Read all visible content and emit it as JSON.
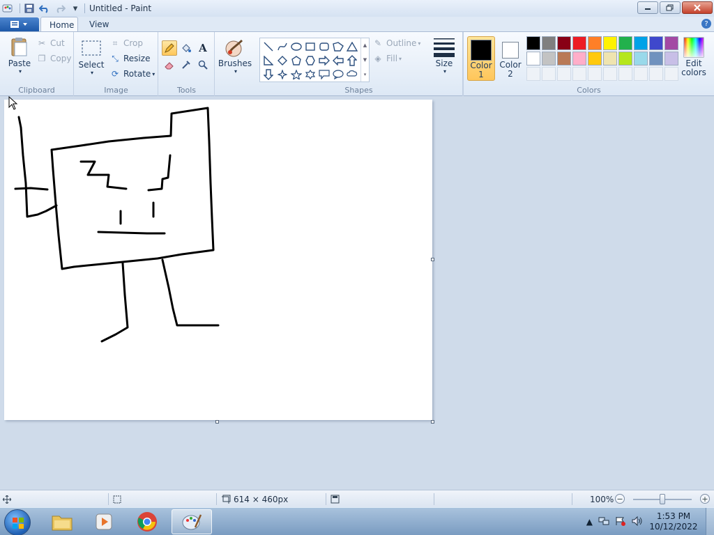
{
  "window": {
    "title": "Untitled - Paint",
    "qat": {
      "customize_caret": "▾"
    }
  },
  "tabs": {
    "home": "Home",
    "view": "View",
    "help": "?"
  },
  "ribbon": {
    "clipboard": {
      "label": "Clipboard",
      "paste": "Paste",
      "cut": "Cut",
      "copy": "Copy"
    },
    "image": {
      "label": "Image",
      "select": "Select",
      "crop": "Crop",
      "resize": "Resize",
      "rotate": "Rotate"
    },
    "tools": {
      "label": "Tools",
      "text_tool": "A"
    },
    "brushes": {
      "label": "Brushes"
    },
    "shapes": {
      "label": "Shapes",
      "outline": "Outline",
      "fill": "Fill"
    },
    "size": {
      "label": "Size"
    },
    "colors": {
      "label": "Colors",
      "color1": {
        "line1": "Color",
        "line2": "1",
        "value": "#000000"
      },
      "color2": {
        "line1": "Color",
        "line2": "2",
        "value": "#ffffff"
      },
      "edit": {
        "line1": "Edit",
        "line2": "colors"
      },
      "palette_row1": [
        "#000000",
        "#7f7f7f",
        "#880015",
        "#ed1c24",
        "#ff7f27",
        "#fff200",
        "#22b14c",
        "#00a2e8",
        "#3f48cc",
        "#a349a4"
      ],
      "palette_row2": [
        "#ffffff",
        "#c3c3c3",
        "#b97a57",
        "#ffaec9",
        "#ffc90e",
        "#efe4b0",
        "#b5e61d",
        "#99d9ea",
        "#7092be",
        "#c8bfe7"
      ]
    }
  },
  "status": {
    "image_size": "614 × 460px",
    "zoom": "100%",
    "zoom_fraction": 0.5
  },
  "taskbar": {
    "time": "1:53 PM",
    "date": "10/12/2022"
  }
}
